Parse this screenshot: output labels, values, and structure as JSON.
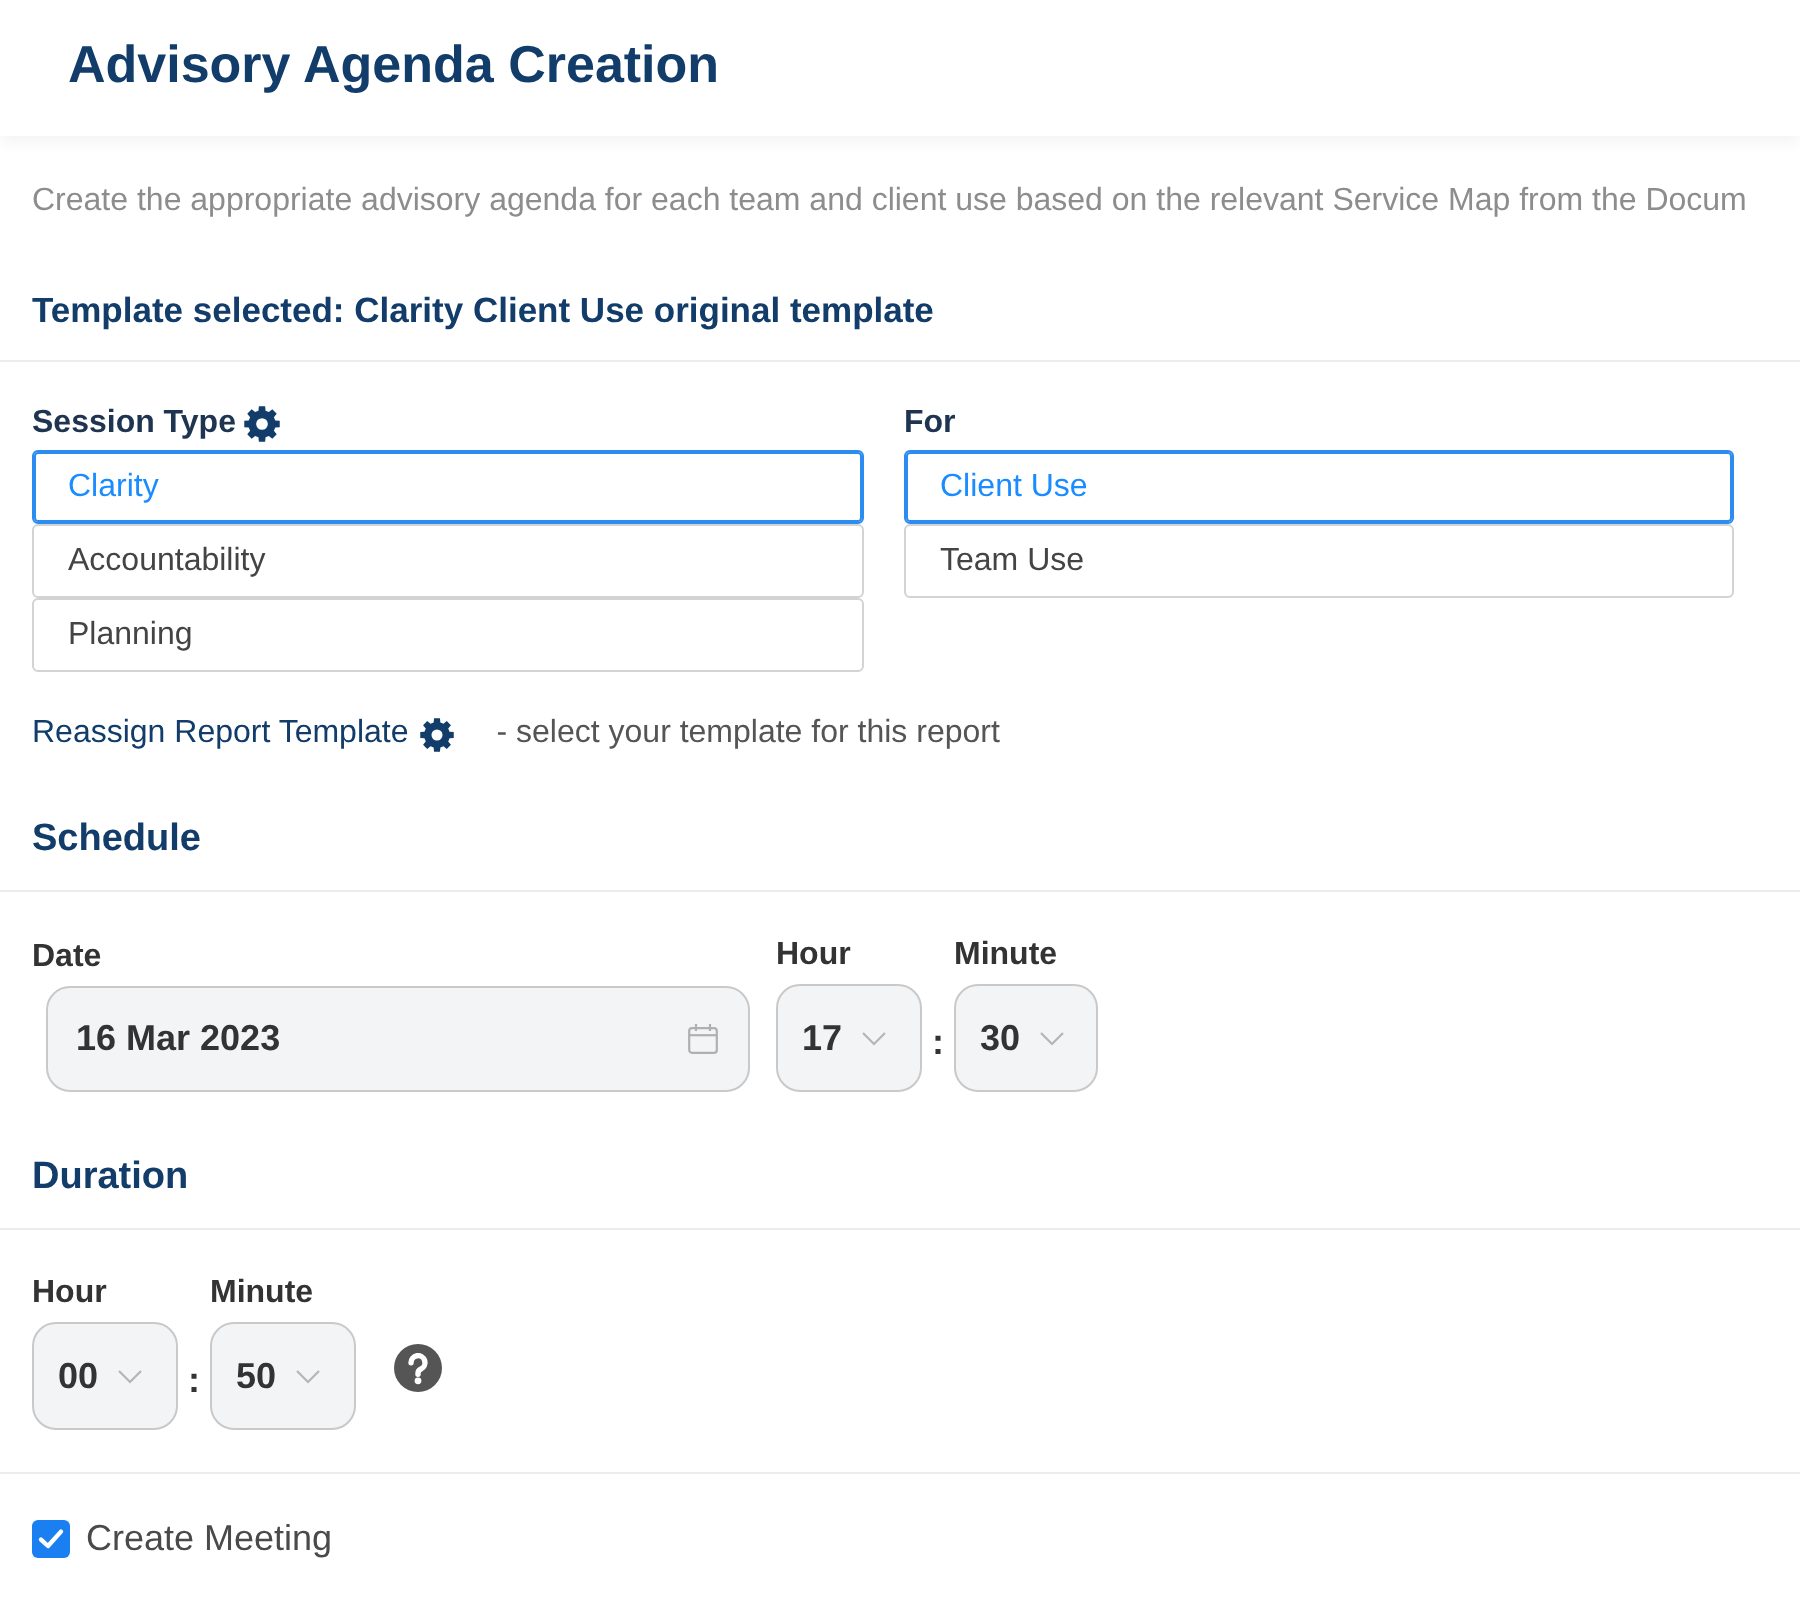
{
  "header": {
    "title": "Advisory Agenda Creation"
  },
  "description": "Create the appropriate advisory agenda for each team and client use based on the relevant Service Map from the Docum",
  "template_heading": "Template selected: Clarity Client Use original template",
  "session_type": {
    "label": "Session Type",
    "options": [
      {
        "label": "Clarity",
        "selected": true
      },
      {
        "label": "Accountability",
        "selected": false
      },
      {
        "label": "Planning",
        "selected": false
      }
    ]
  },
  "for": {
    "label": "For",
    "options": [
      {
        "label": "Client Use",
        "selected": true
      },
      {
        "label": "Team Use",
        "selected": false
      }
    ]
  },
  "reassign": {
    "link": "Reassign Report Template",
    "hint": "- select your template for this report"
  },
  "schedule": {
    "heading": "Schedule",
    "date": {
      "label": "Date",
      "value": "16 Mar 2023"
    },
    "hour": {
      "label": "Hour",
      "value": "17"
    },
    "separator": ":",
    "minute": {
      "label": "Minute",
      "value": "30"
    }
  },
  "duration": {
    "heading": "Duration",
    "hour": {
      "label": "Hour",
      "value": "00"
    },
    "separator": ":",
    "minute": {
      "label": "Minute",
      "value": "50"
    }
  },
  "create_meeting": {
    "label": "Create Meeting",
    "checked": true
  }
}
